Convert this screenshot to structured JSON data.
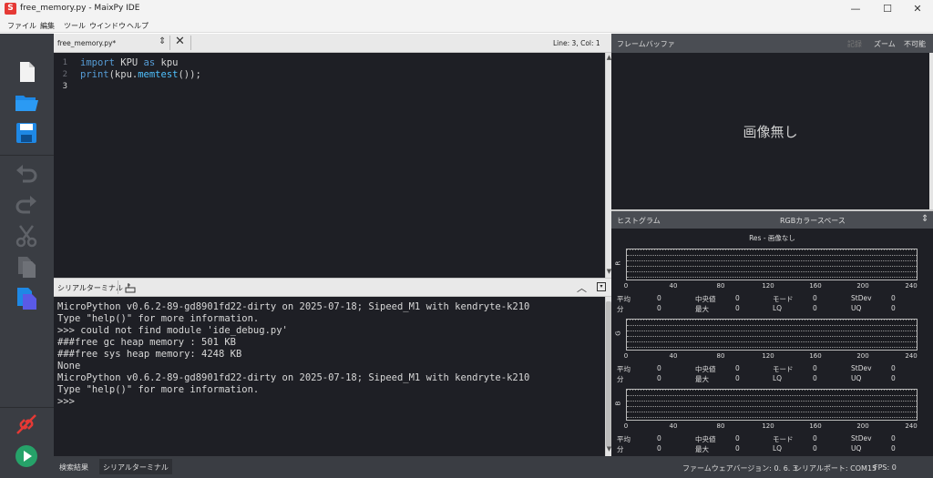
{
  "window": {
    "title": "free_memory.py - MaixPy IDE",
    "icon_letter": "S",
    "minimize": "—",
    "maximize": "☐",
    "close": "✕"
  },
  "menu": [
    "ファイル",
    "編集",
    "ツール",
    "ウインドウ",
    "ヘルプ"
  ],
  "editor": {
    "tab_name": "free_memory.py*",
    "cursor_pos": "Line: 3, Col: 1",
    "line_numbers": [
      "1",
      "2",
      "3"
    ],
    "code": [
      [
        {
          "t": "import",
          "c": "#569cd6"
        },
        {
          "t": " KPU ",
          "c": "#d4d4d4"
        },
        {
          "t": "as",
          "c": "#569cd6"
        },
        {
          "t": " kpu",
          "c": "#d4d4d4"
        }
      ],
      [
        {
          "t": "print",
          "c": "#569cd6"
        },
        {
          "t": "(kpu.",
          "c": "#d4d4d4"
        },
        {
          "t": "memtest",
          "c": "#4fc1ff"
        },
        {
          "t": "());",
          "c": "#d4d4d4"
        }
      ]
    ]
  },
  "terminal": {
    "title": "シリアルターミナル",
    "lines": [
      "MicroPython v0.6.2-89-gd8901fd22-dirty on 2025-07-18; Sipeed_M1 with kendryte-k210",
      "Type \"help()\" for more information.",
      ">>> could not find module 'ide_debug.py'",
      "###free gc heap memory : 501 KB",
      "###free sys heap memory: 4248 KB",
      "None",
      "MicroPython v0.6.2-89-gd8901fd22-dirty on 2025-07-18; Sipeed_M1 with kendryte-k210",
      "Type \"help()\" for more information.",
      ">>>"
    ]
  },
  "framebuffer": {
    "title": "フレームバッファ",
    "record": "記録",
    "zoom": "ズーム",
    "disable": "不可能",
    "no_image": "画像無し"
  },
  "histogram": {
    "title": "ヒストグラム",
    "colorspace": "RGBカラースペース",
    "caption": "Res - 画像なし",
    "ticks": [
      "0",
      "40",
      "80",
      "120",
      "160",
      "200",
      "240"
    ],
    "stat_labels": {
      "mean": "平均",
      "median": "中央値",
      "mode": "モード",
      "stdev": "StDev",
      "min": "分",
      "max": "最大",
      "lq": "LQ",
      "uq": "UQ"
    },
    "channels": [
      {
        "label": "R",
        "mean": "0",
        "median": "0",
        "mode": "0",
        "stdev": "0",
        "min": "0",
        "max": "0",
        "lq": "0",
        "uq": "0"
      },
      {
        "label": "G",
        "mean": "0",
        "median": "0",
        "mode": "0",
        "stdev": "0",
        "min": "0",
        "max": "0",
        "lq": "0",
        "uq": "0"
      },
      {
        "label": "B",
        "mean": "0",
        "median": "0",
        "mode": "0",
        "stdev": "0",
        "min": "0",
        "max": "0",
        "lq": "0",
        "uq": "0"
      }
    ]
  },
  "statusbar": {
    "search_results": "検索結果",
    "serial_terminal": "シリアルターミナル",
    "firmware": "ファームウェアバージョン: 0. 6. 3",
    "serial_port": "シリアルポート: COM15",
    "fps": "FPS: 0"
  },
  "colors": {
    "accent": "#1e88e5",
    "run": "#26a269",
    "disconnect": "#e53935"
  }
}
